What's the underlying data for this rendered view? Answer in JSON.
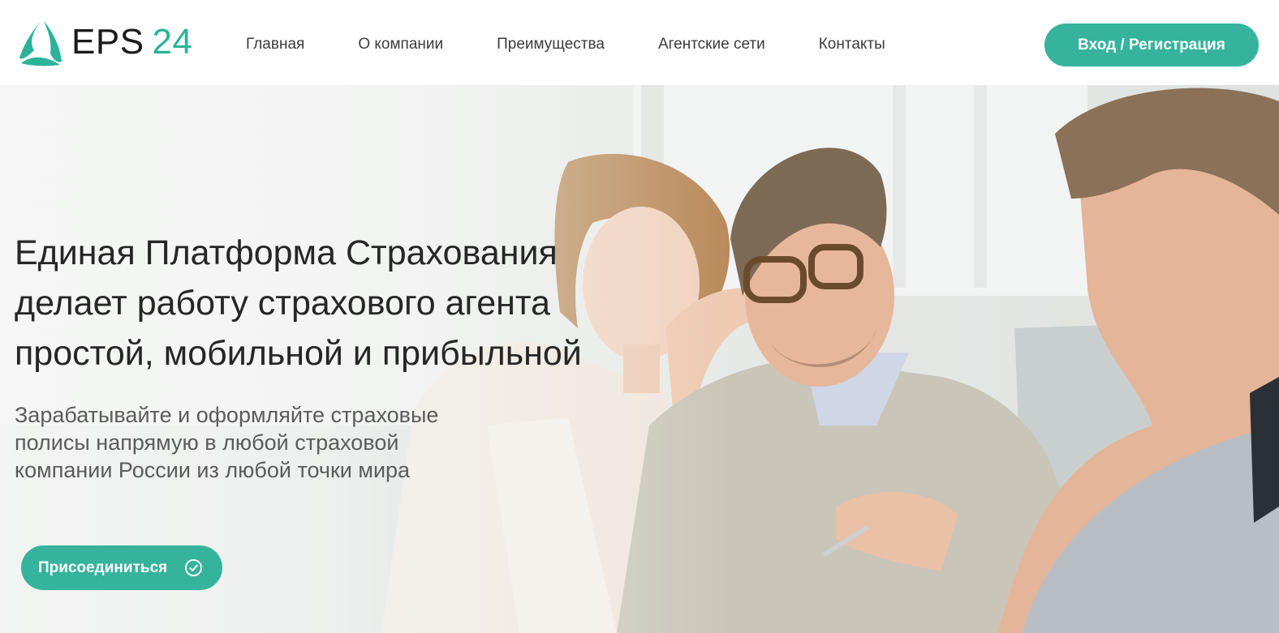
{
  "header": {
    "logo": {
      "brand": "EPS",
      "number": "24",
      "accent_color": "#2bb39a",
      "icon": "triangle-logo-icon"
    },
    "nav": [
      {
        "label": "Главная"
      },
      {
        "label": "О компании"
      },
      {
        "label": "Преимущества"
      },
      {
        "label": "Агентские сети"
      },
      {
        "label": "Контакты"
      }
    ],
    "login_button": "Вход / Регистрация"
  },
  "hero": {
    "title_lines": [
      "Единая Платформа Страхования",
      "делает работу страхового агента",
      "простой, мобильной и прибыльной"
    ],
    "subtitle_lines": [
      "Зарабатывайте и оформляйте страховые",
      "полисы напрямую в любой страховой",
      "компании России из любой точки мира"
    ],
    "join_button": "Присоединиться",
    "join_icon": "check-circle-icon",
    "button_color": "#36b39c"
  }
}
